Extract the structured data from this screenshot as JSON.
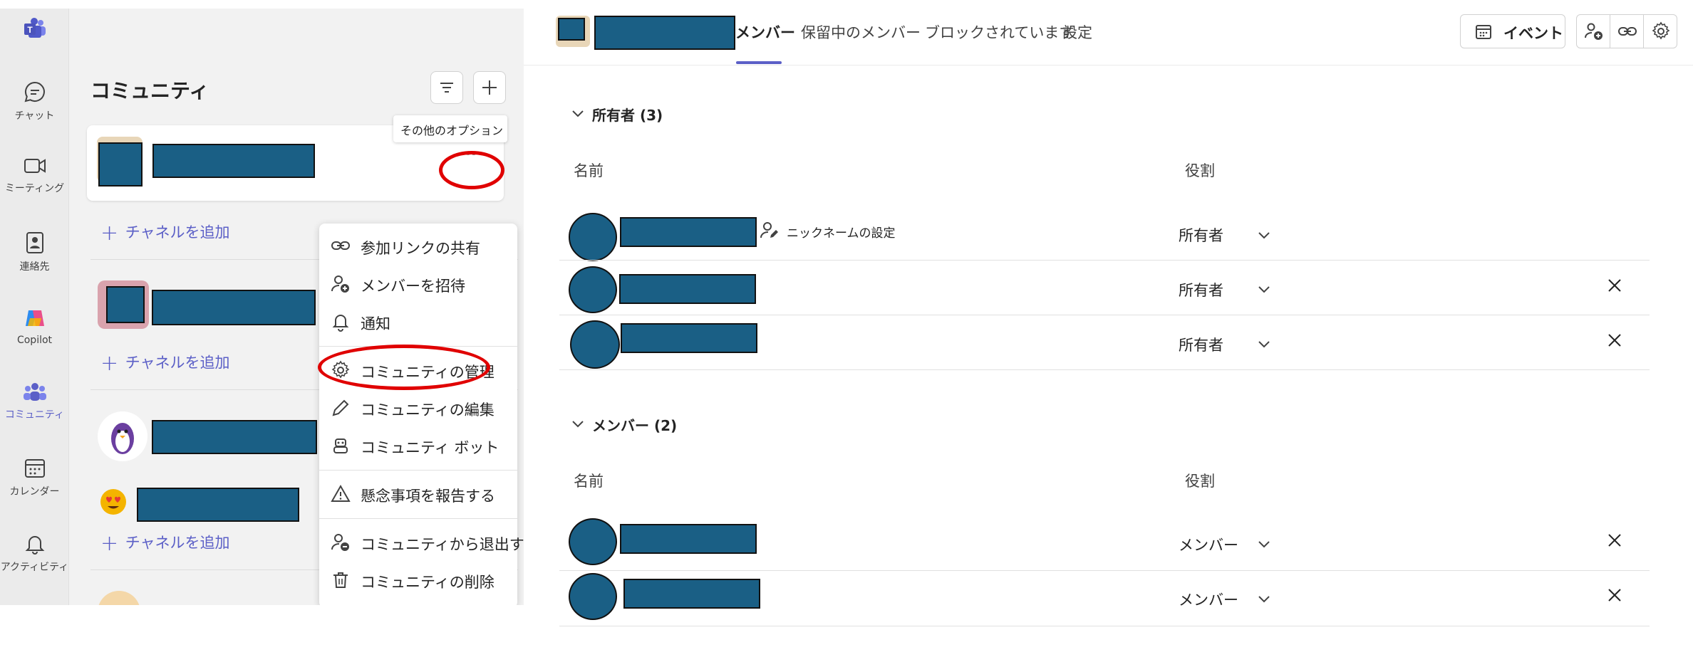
{
  "rail": {
    "items": [
      {
        "id": "teams",
        "label": ""
      },
      {
        "id": "chat",
        "label": "チャット"
      },
      {
        "id": "meeting",
        "label": "ミーティング"
      },
      {
        "id": "contacts",
        "label": "連絡先"
      },
      {
        "id": "copilot",
        "label": "Copilot"
      },
      {
        "id": "community",
        "label": "コミュニティ"
      },
      {
        "id": "calendar",
        "label": "カレンダー"
      },
      {
        "id": "activity",
        "label": "アクティビティ"
      }
    ]
  },
  "communities": {
    "title": "コミュニティ",
    "tooltip": "その他のオプション",
    "add_channel": "チャネルを追加"
  },
  "context_menu": {
    "items": [
      {
        "label": "参加リンクの共有",
        "icon": "link-icon"
      },
      {
        "label": "メンバーを招待",
        "icon": "person-add-icon"
      },
      {
        "label": "通知",
        "icon": "bell-icon"
      },
      {
        "label": "コミュニティの管理",
        "icon": "gear-icon"
      },
      {
        "label": "コミュニティの編集",
        "icon": "pencil-icon"
      },
      {
        "label": "コミュニティ ボット",
        "icon": "bot-icon"
      },
      {
        "label": "懸念事項を報告する",
        "icon": "warning-icon"
      },
      {
        "label": "コミュニティから退出する",
        "icon": "person-leave-icon"
      },
      {
        "label": "コミュニティの削除",
        "icon": "trash-icon"
      }
    ]
  },
  "header": {
    "tabs": [
      {
        "label": "メンバー",
        "active": true
      },
      {
        "label": "保留中のメンバー",
        "active": false
      },
      {
        "label": "ブロックされています",
        "active": false
      },
      {
        "label": "設定",
        "active": false
      }
    ],
    "event_button": "イベント"
  },
  "owners": {
    "title": "所有者 (3)",
    "col_name": "名前",
    "col_role": "役割",
    "nickname_label": "ニックネームの設定",
    "rows": [
      {
        "role": "所有者"
      },
      {
        "role": "所有者"
      },
      {
        "role": "所有者"
      }
    ]
  },
  "members": {
    "title": "メンバー (2)",
    "col_name": "名前",
    "col_role": "役割",
    "rows": [
      {
        "role": "メンバー"
      },
      {
        "role": "メンバー"
      }
    ]
  },
  "colors": {
    "accent": "#5b5fc7",
    "redaction": "#1a5f85",
    "highlight": "#e00000"
  }
}
